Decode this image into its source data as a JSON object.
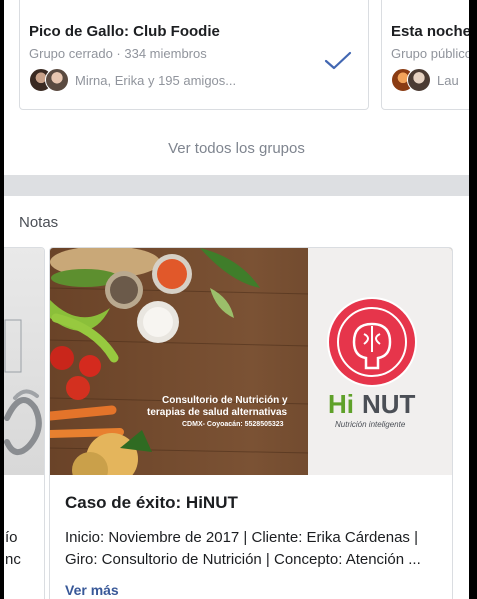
{
  "groups": {
    "cards": [
      {
        "name": "Pico de Gallo: Club Foodie",
        "meta": "Grupo cerrado · 334 miembros",
        "friends": "Mirna, Erika y 195 amigos..."
      },
      {
        "name": "Esta noche:",
        "meta": "Grupo público",
        "friends": "Lau"
      }
    ],
    "see_all": "Ver todos los grupos"
  },
  "notes": {
    "title": "Notas",
    "prev_card_text": [
      "ío",
      "nc"
    ],
    "card": {
      "image": {
        "line1": "Consultorio de Nutrición y",
        "line2": "terapias de salud alternativas",
        "line3": "CDMX- Coyoacán: 5528505323",
        "logo_hi": "Hi",
        "logo_nut": "NUT",
        "tagline": "Nutrición inteligente"
      },
      "title": "Caso de éxito: HiNUT",
      "summary": "Inicio:  Noviembre de 2017 | Cliente: Erika Cárdenas | Giro: Consultorio de Nutrición | Concepto: Atención ...",
      "more": "Ver más"
    }
  },
  "colors": {
    "link": "#385898",
    "check": "#4267b2",
    "logo_red": "#e6354b",
    "logo_green": "#5fa12a",
    "logo_gray": "#4b4f56"
  }
}
